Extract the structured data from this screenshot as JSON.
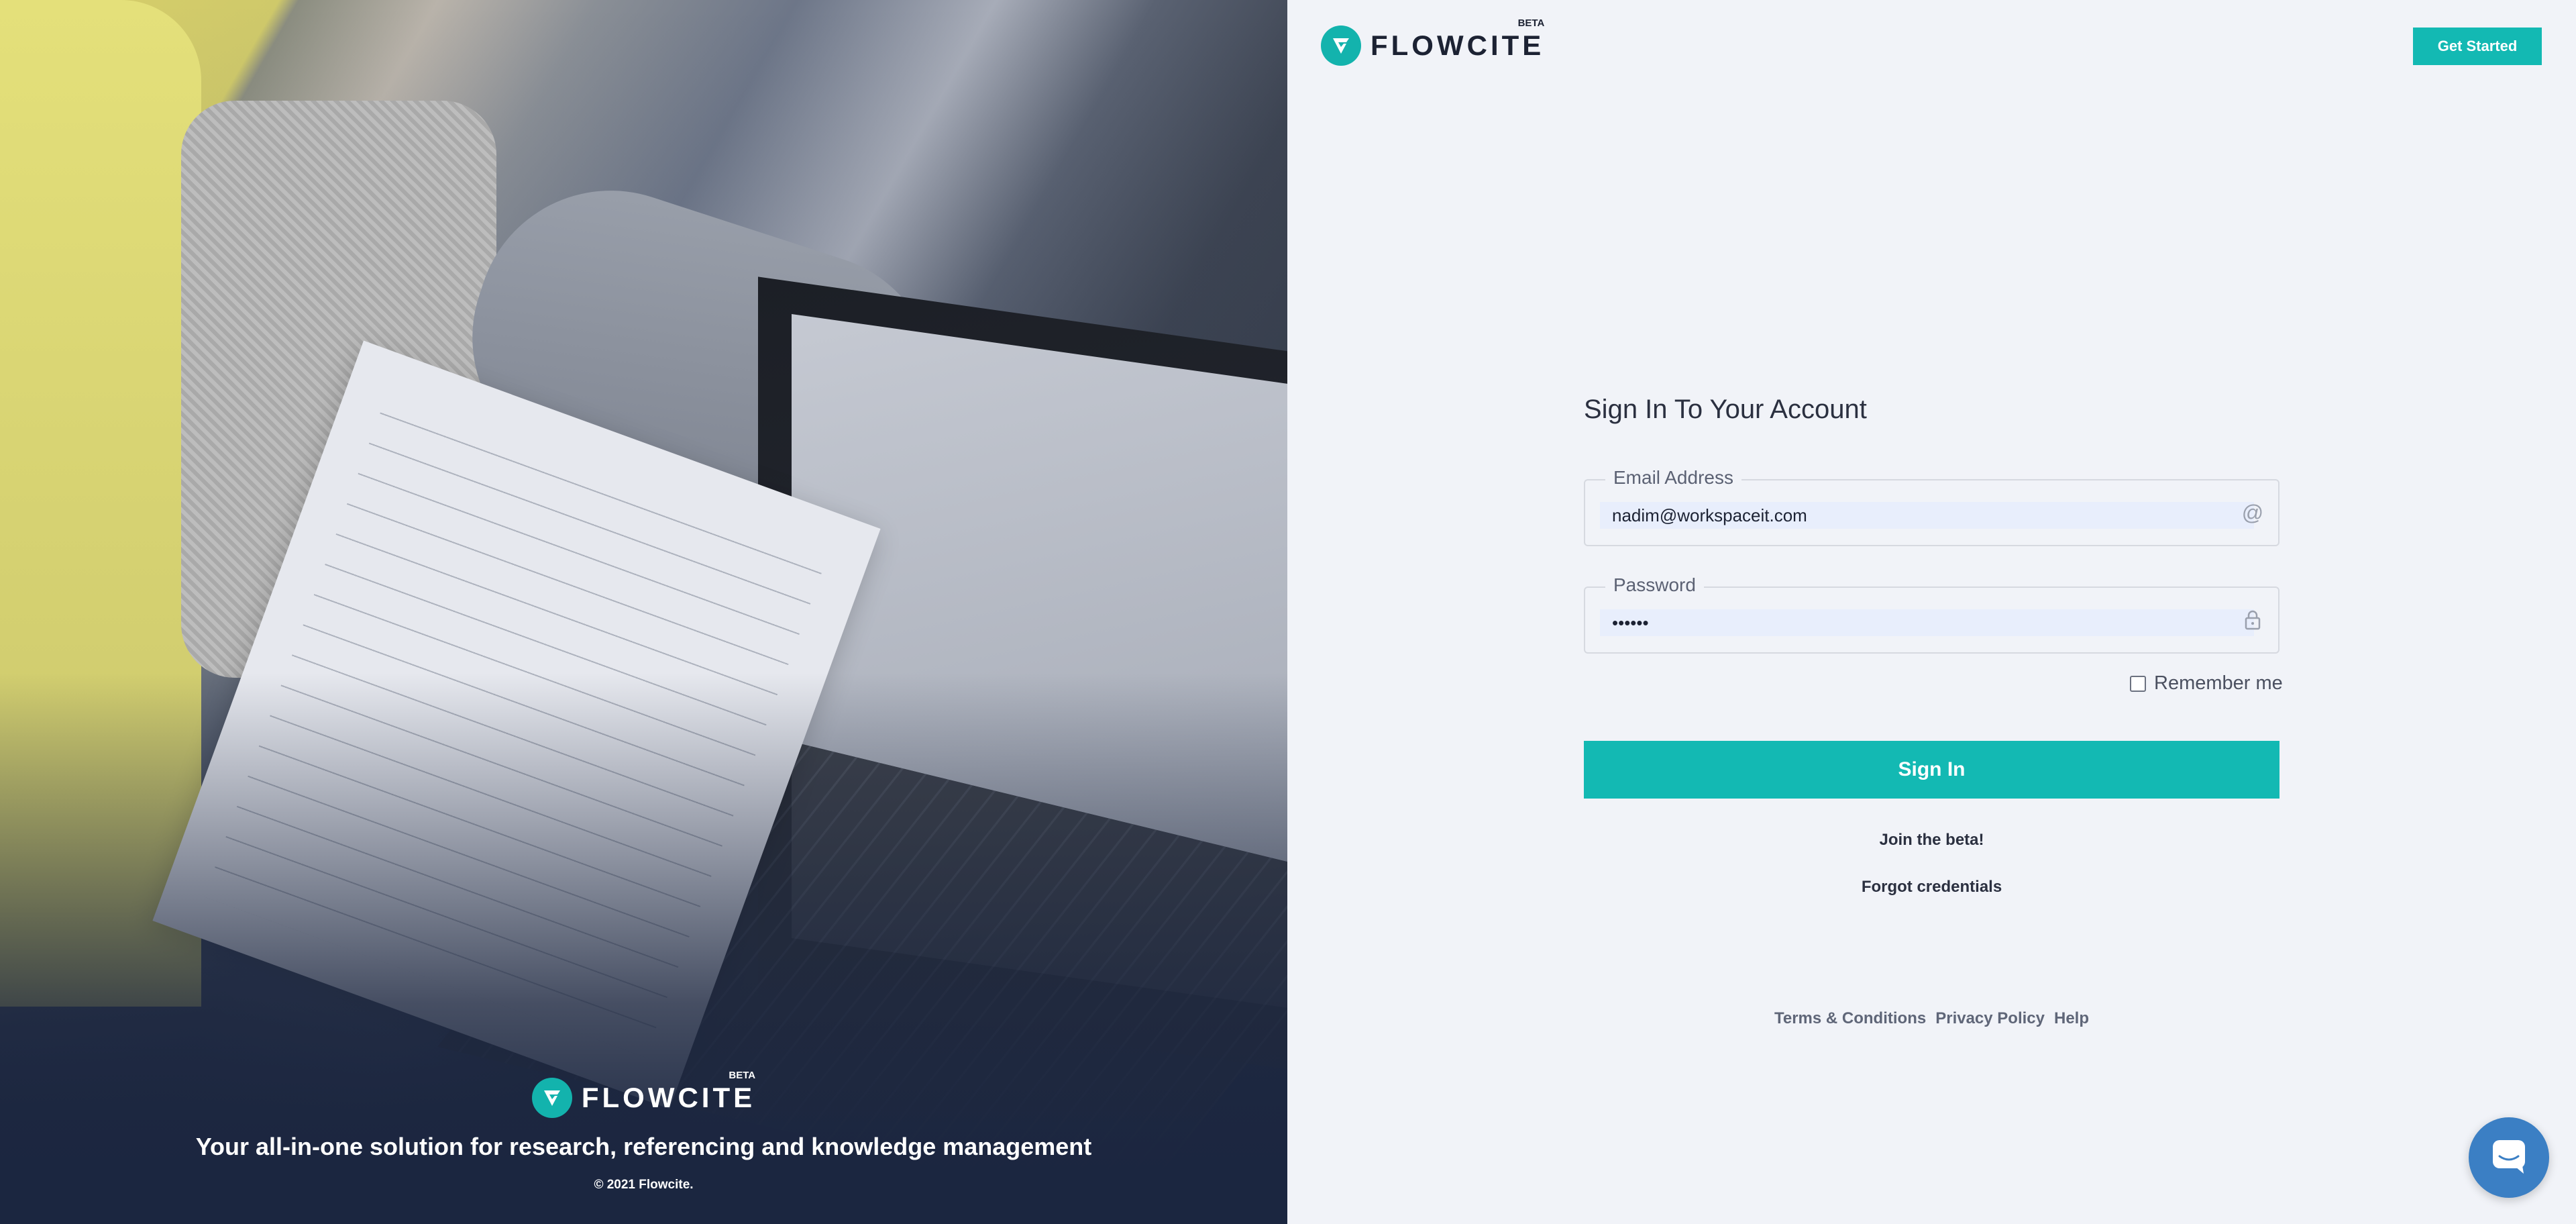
{
  "brand": {
    "name": "FLOWCITE",
    "badge": "BETA",
    "accent": "#13b9b3"
  },
  "header": {
    "get_started_label": "Get Started"
  },
  "hero": {
    "tagline": "Your all-in-one solution for research, referencing and knowledge management",
    "copyright": "© 2021 Flowcite."
  },
  "form": {
    "title": "Sign In To Your Account",
    "email": {
      "label": "Email Address",
      "value": "nadim@workspaceit.com",
      "icon": "at-icon"
    },
    "password": {
      "label": "Password",
      "value": "••••••",
      "icon": "lock-icon"
    },
    "remember_label": "Remember me",
    "remember_checked": false,
    "submit_label": "Sign In",
    "join_label": "Join the beta!",
    "forgot_label": "Forgot credentials"
  },
  "footer": {
    "links": [
      "Terms & Conditions",
      "Privacy Policy",
      "Help"
    ]
  },
  "chat": {
    "icon": "chat-icon"
  }
}
